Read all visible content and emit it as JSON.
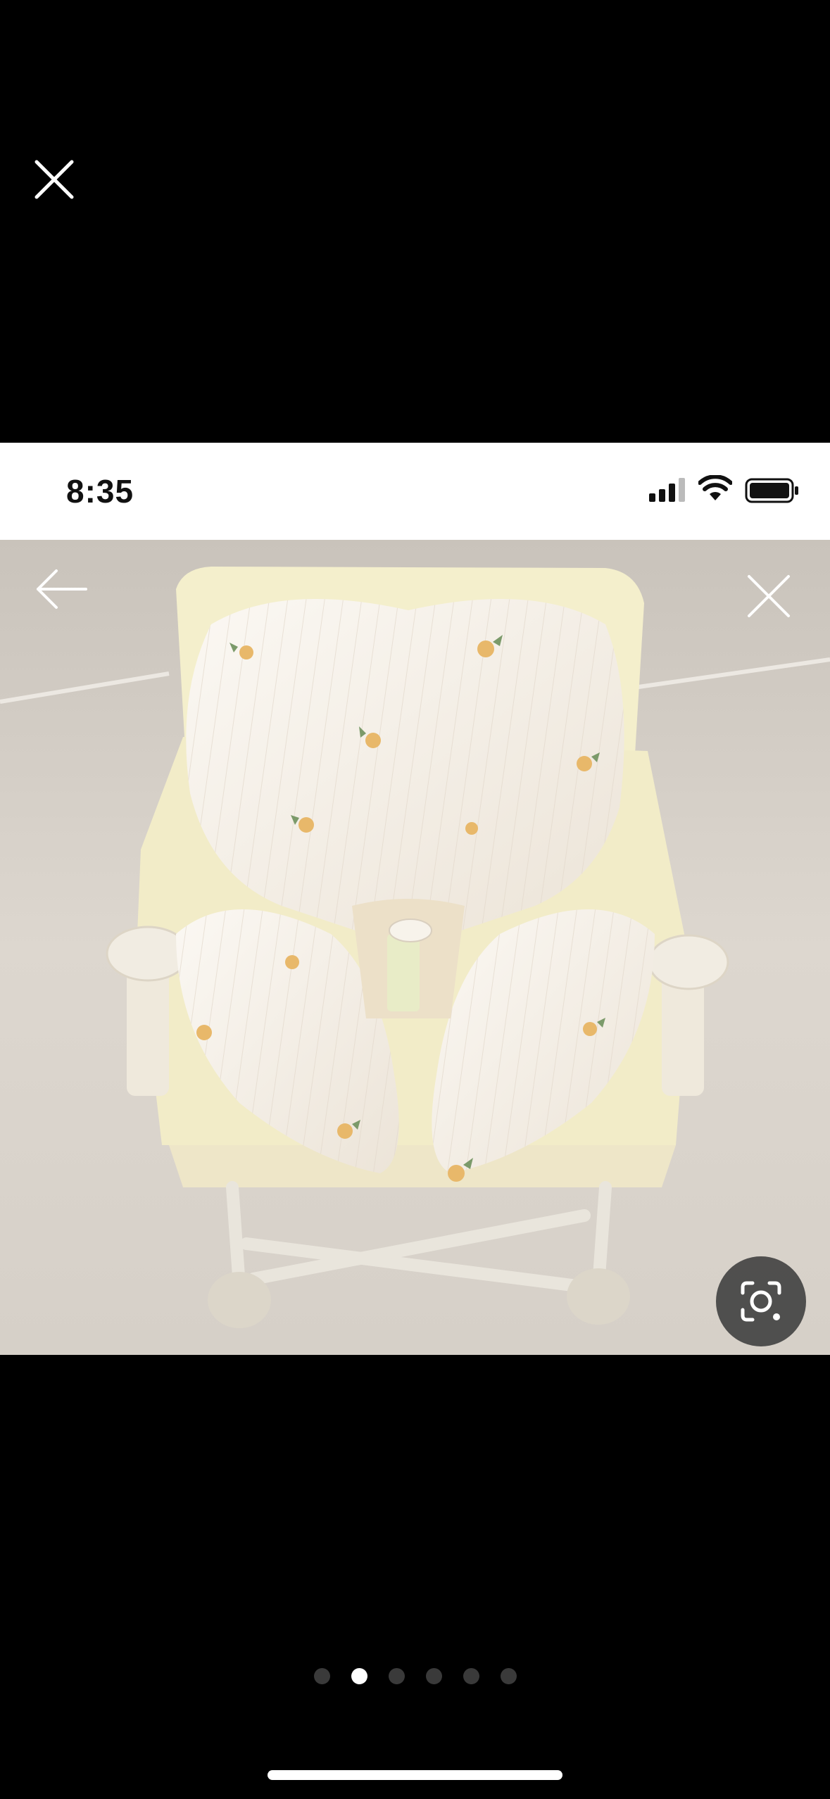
{
  "viewer": {
    "close_icon": "close-icon",
    "page_dots": {
      "count": 6,
      "active_index": 1
    }
  },
  "embedded_screenshot": {
    "status_bar": {
      "time": "8:35",
      "signal_icon": "cellular-signal-icon",
      "wifi_icon": "wifi-icon",
      "battery_icon": "battery-icon"
    },
    "photo": {
      "back_icon": "back-arrow-icon",
      "close_icon": "close-icon",
      "lens_icon": "visual-search-lens-icon"
    }
  },
  "colors": {
    "background": "#000000",
    "active_dot": "#ffffff",
    "inactive_dot": "#3a3a3a",
    "cushion": "#f4eee6",
    "seat_frame": "#f3edc9"
  }
}
